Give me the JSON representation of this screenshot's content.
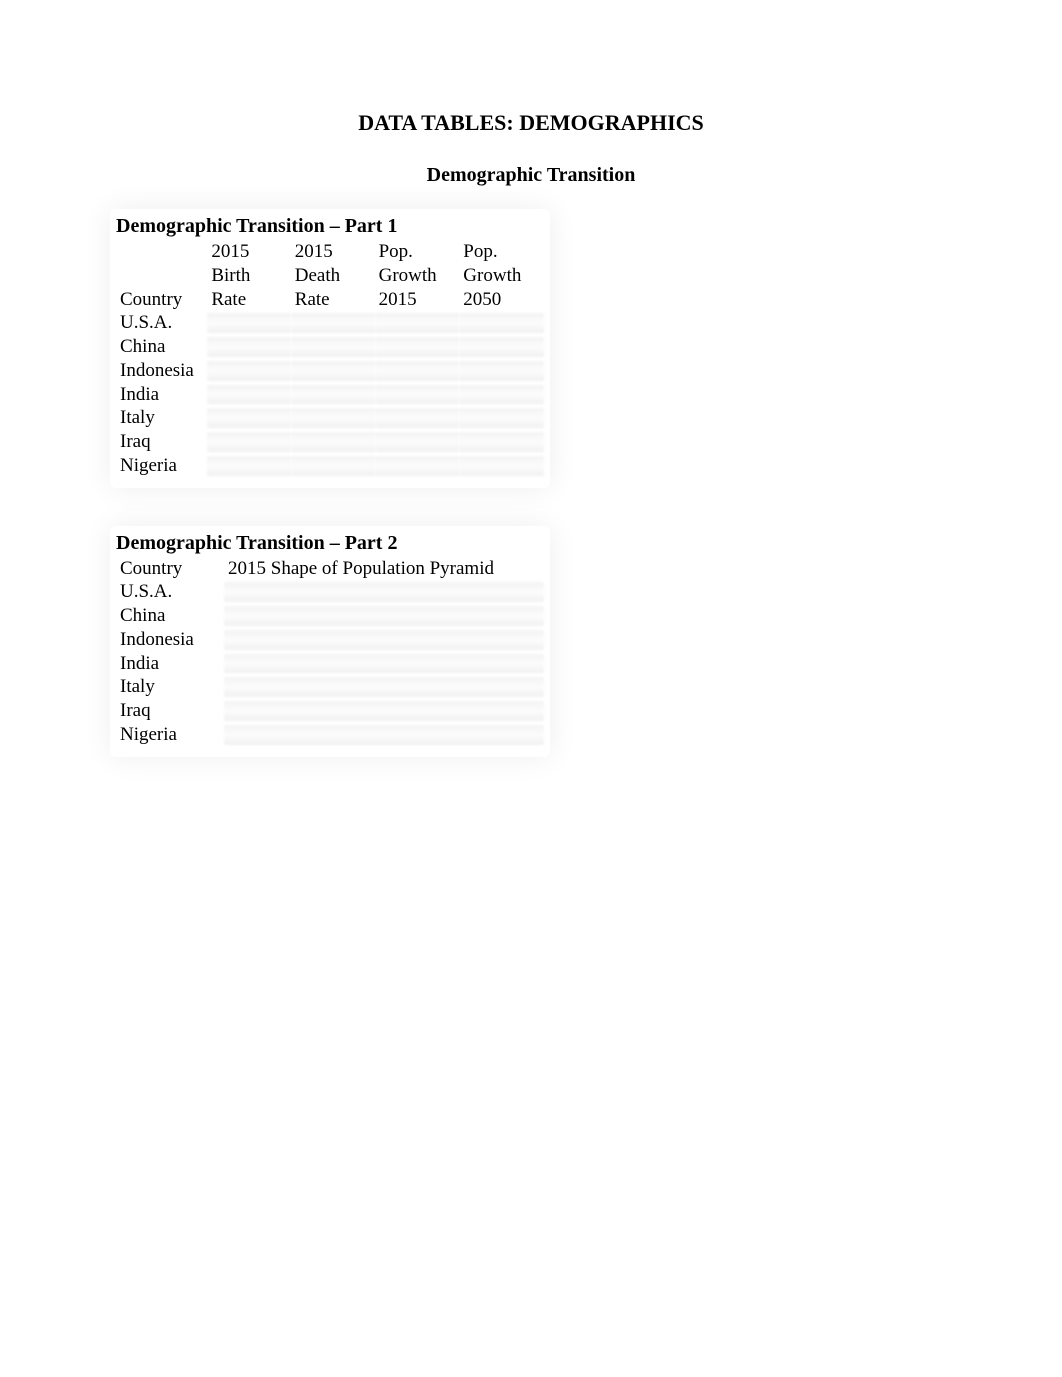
{
  "title": "DATA TABLES: DEMOGRAPHICS",
  "subtitle": "Demographic Transition",
  "table1": {
    "title": "Demographic Transition – Part 1",
    "headers": {
      "col0": "Country",
      "col1_line1": "2015",
      "col1_line2": "Birth",
      "col1_line3": "Rate",
      "col2_line1": "2015",
      "col2_line2": "Death",
      "col2_line3": "Rate",
      "col3_line1": "Pop.",
      "col3_line2": "Growth",
      "col3_line3": "2015",
      "col4_line1": "Pop.",
      "col4_line2": "Growth",
      "col4_line3": "2050"
    },
    "rows": [
      {
        "country": "U.S.A."
      },
      {
        "country": "China"
      },
      {
        "country": "Indonesia"
      },
      {
        "country": "India"
      },
      {
        "country": "Italy"
      },
      {
        "country": "Iraq"
      },
      {
        "country": "Nigeria"
      }
    ]
  },
  "table2": {
    "title": "Demographic Transition – Part 2",
    "headers": {
      "col0": "Country",
      "col1": "2015 Shape of  Population Pyramid"
    },
    "rows": [
      {
        "country": "U.S.A."
      },
      {
        "country": "China"
      },
      {
        "country": "Indonesia"
      },
      {
        "country": "India"
      },
      {
        "country": "Italy"
      },
      {
        "country": "Iraq"
      },
      {
        "country": "Nigeria"
      }
    ]
  }
}
